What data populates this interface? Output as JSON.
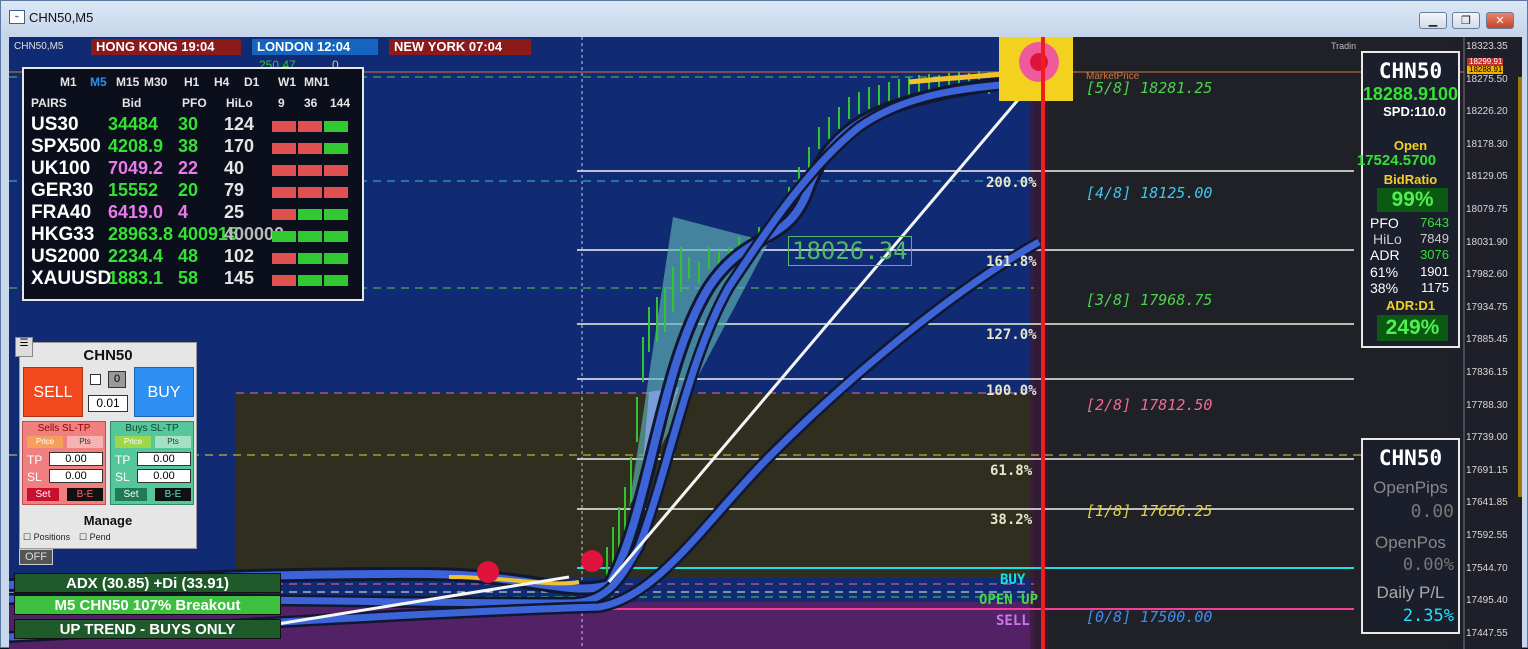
{
  "window": {
    "title": "CHN50,M5"
  },
  "chart_header": {
    "symbol_label": "CHN50,M5",
    "sessions": [
      {
        "label": "HONG KONG",
        "time": "19:04",
        "color": "#8b1a1a"
      },
      {
        "label": "LONDON",
        "time": "12:04",
        "color": "#1565c0"
      },
      {
        "label": "NEW YORK",
        "time": "07:04",
        "color": "#8b1a1a"
      }
    ],
    "trading_label": "Tradin",
    "top_small_numbers": [
      "250.47",
      "0"
    ],
    "market_price_label": "MarketPrice",
    "big_level_label": "18026.34"
  },
  "price_axis": {
    "ticks": [
      "18323.35",
      "18275.50",
      "18226.20",
      "18178.30",
      "18129.05",
      "18079.75",
      "18031.90",
      "17982.60",
      "17934.75",
      "17885.45",
      "17836.15",
      "17788.30",
      "17739.00",
      "17691.15",
      "17641.85",
      "17592.55",
      "17544.70",
      "17495.40",
      "17447.55"
    ],
    "current_tags": [
      "18299.91",
      "18288.91"
    ]
  },
  "fib_levels": [
    "200.0%",
    "161.8%",
    "127.0%",
    "100.0%",
    "61.8%",
    "38.2%"
  ],
  "murrey_levels": [
    {
      "label": "[5/8]  18281.25",
      "color": "#4cd34c"
    },
    {
      "label": "[4/8]  18125.00",
      "color": "#3dc6f0"
    },
    {
      "label": "[3/8]  17968.75",
      "color": "#4cd34c"
    },
    {
      "label": "[2/8]  17812.50",
      "color": "#f06a98"
    },
    {
      "label": "[1/8]  17656.25",
      "color": "#e7d23d"
    },
    {
      "label": "[0/8]  17500.00",
      "color": "#3d8ef0"
    }
  ],
  "zone_labels": {
    "buy": "BUY",
    "open_up": "OPEN UP",
    "sell": "SELL"
  },
  "market_watch": {
    "timeframes": [
      "M1",
      "M5",
      "M15",
      "M30",
      "H1",
      "H4",
      "D1",
      "W1",
      "MN1"
    ],
    "active_timeframe": "M5",
    "col_headers": [
      "PAIRS",
      "Bid",
      "PFO",
      "HiLo",
      "9",
      "36",
      "144"
    ],
    "rows": [
      {
        "pair": "US30",
        "bid": "34484",
        "pfo": "30",
        "hilo": "124",
        "bid_color": "#33e233",
        "bars": [
          "#e05050",
          "#e05050",
          "#32c832"
        ]
      },
      {
        "pair": "SPX500",
        "bid": "4208.9",
        "pfo": "38",
        "hilo": "170",
        "bid_color": "#33e233",
        "bars": [
          "#e05050",
          "#e05050",
          "#32c832"
        ]
      },
      {
        "pair": "UK100",
        "bid": "7049.2",
        "pfo": "22",
        "hilo": "40",
        "bid_color": "#e97ae9",
        "bars": [
          "#e05050",
          "#e05050",
          "#e05050"
        ]
      },
      {
        "pair": "GER30",
        "bid": "15552",
        "pfo": "20",
        "hilo": "79",
        "bid_color": "#33e233",
        "bars": [
          "#e05050",
          "#e05050",
          "#e05050"
        ]
      },
      {
        "pair": "FRA40",
        "bid": "6419.0",
        "pfo": "4",
        "hilo": "25",
        "bid_color": "#e97ae9",
        "bars": [
          "#e05050",
          "#32c832",
          "#32c832"
        ]
      },
      {
        "pair": "HKG33",
        "bid": "28963.8",
        "pfo": "400915",
        "hilo": "400000",
        "bid_color": "#33e233",
        "bars": [
          "#32c832",
          "#32c832",
          "#32c832"
        ]
      },
      {
        "pair": "US2000",
        "bid": "2234.4",
        "pfo": "48",
        "hilo": "102",
        "bid_color": "#33e233",
        "bars": [
          "#e05050",
          "#32c832",
          "#32c832"
        ]
      },
      {
        "pair": "XAUUSD",
        "bid": "1883.1",
        "pfo": "58",
        "hilo": "145",
        "bid_color": "#33e233",
        "bars": [
          "#e05050",
          "#32c832",
          "#32c832"
        ]
      }
    ]
  },
  "trade_panel": {
    "symbol": "CHN50",
    "sell_label": "SELL",
    "buy_label": "BUY",
    "lot_count": "0",
    "lot_size": "0.01",
    "sells_header": "Sells SL-TP",
    "buys_header": "Buys SL-TP",
    "price_tab": "Price",
    "pts_tab": "Pts",
    "tp_label": "TP",
    "sl_label": "SL",
    "sell_tp": "0.00",
    "sell_sl": "0.00",
    "buy_tp": "0.00",
    "buy_sl": "0.00",
    "set_label": "Set",
    "be_label": "B-E",
    "manage_label": "Manage",
    "positions_label": "Positions",
    "pend_label": "Pend",
    "off_label": "OFF"
  },
  "status": {
    "adx": "ADX (30.85)   +Di (33.91)",
    "breakout": "M5 CHN50 107% Breakout",
    "trend": "UP TREND - BUYS ONLY"
  },
  "info_panel": {
    "symbol": "CHN50",
    "price": "18288.9100",
    "spread": "SPD:110.0",
    "open_label": "Open",
    "open_value": "17524.5700",
    "bidratio_label": "BidRatio",
    "bidratio_value": "99%",
    "pfo_label": "PFO",
    "pfo_value": "7643",
    "hilo_label": "HiLo",
    "hilo_value": "7849",
    "adr_label": "ADR",
    "adr_value": "3076",
    "r61_label": "61%",
    "r61_value": "1901",
    "r38_label": "38%",
    "r38_value": "1175",
    "adrd1_label": "ADR:D1",
    "adrd1_value": "249%"
  },
  "pnl_panel": {
    "symbol": "CHN50",
    "open_pips_label": "OpenPips",
    "open_pips_value": "0.00",
    "open_pos_label": "OpenPos",
    "open_pos_value": "0.00%",
    "daily_pl_label": "Daily P/L",
    "daily_pl_value": "2.35%"
  }
}
